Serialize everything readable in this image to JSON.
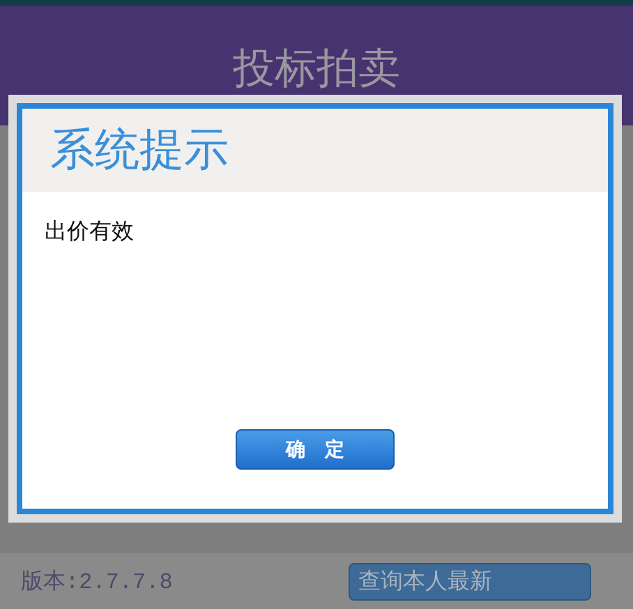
{
  "header": {
    "title": "投标拍卖"
  },
  "footer": {
    "version": "版本:2.7.7.8",
    "button": "查询本人最新"
  },
  "dialog": {
    "title": "系统提示",
    "message": "出价有效",
    "button": "确　定"
  }
}
